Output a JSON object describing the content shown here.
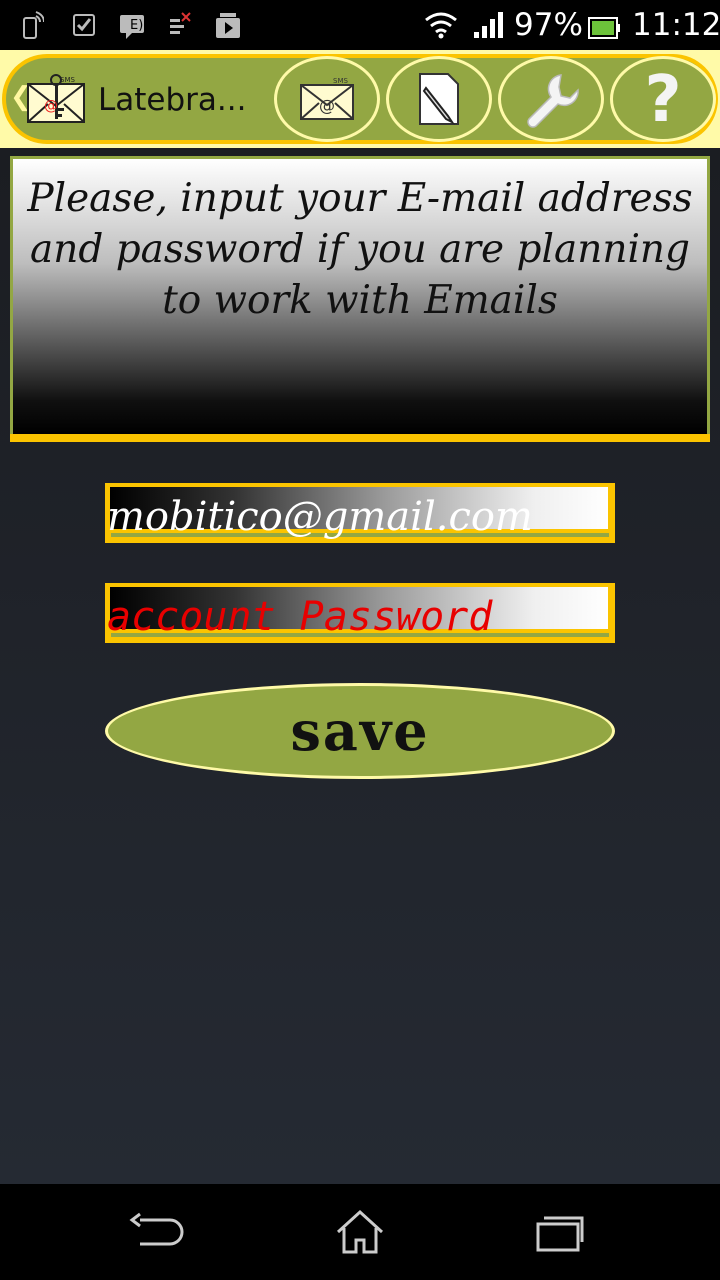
{
  "status_bar": {
    "battery_percent": "97%",
    "time": "11:12",
    "icons": [
      "phone-signal-icon",
      "task-check-icon",
      "notes-icon",
      "missed-call-icon",
      "media-icon",
      "wifi-icon",
      "cell-signal-icon",
      "battery-icon"
    ]
  },
  "action_bar": {
    "title": "Latebra...",
    "logo": "key-mail-logo",
    "buttons": [
      "email-sms-icon",
      "note-edit-icon",
      "wrench-settings-icon",
      "help-question-icon"
    ],
    "colors": {
      "accent": "#93a743",
      "border": "#fbc400",
      "light": "#fffaa8"
    }
  },
  "message": {
    "text": "Please, input your E-mail address and password if you are planning to work with Emails"
  },
  "form": {
    "email_value": "mobitico@gmail.com",
    "password_placeholder": "account Password",
    "save_label": "save"
  },
  "nav_bar": {
    "buttons": [
      "back-icon",
      "home-icon",
      "recents-icon"
    ]
  }
}
